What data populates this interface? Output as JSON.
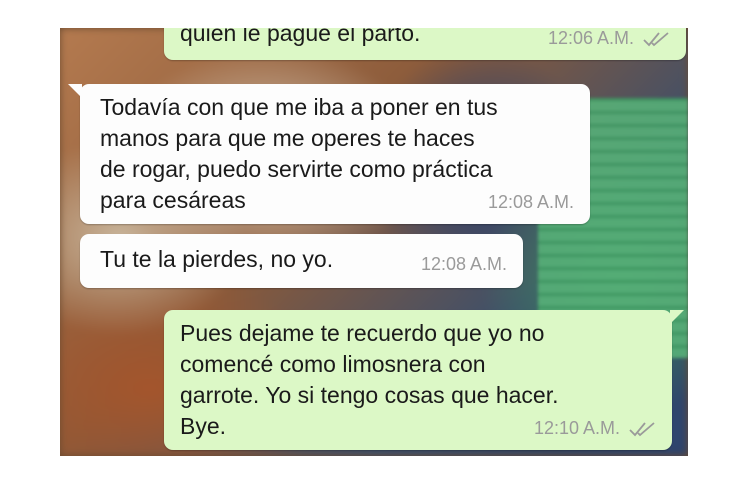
{
  "messages": [
    {
      "direction": "outgoing",
      "text": "quien le pague el parto.",
      "time": "12:06 A.M.",
      "status_icon": "double-check-icon"
    },
    {
      "direction": "incoming",
      "text": "Todavía con que me iba a poner en tus\nmanos para que me operes te haces\nde rogar, puedo servirte como práctica\npara cesáreas",
      "time": "12:08 A.M."
    },
    {
      "direction": "incoming",
      "text": "Tu te la pierdes, no yo.",
      "time": "12:08 A.M."
    },
    {
      "direction": "outgoing",
      "text": "Pues dejame te recuerdo que yo no\ncomencé como limosnera con\ngarrote. Yo si tengo cosas que hacer.\nBye.",
      "time": "12:10 A.M.",
      "status_icon": "double-check-icon"
    }
  ],
  "colors": {
    "incoming_bubble": "#fdfdfd",
    "outgoing_bubble": "#dcf8c6",
    "timestamp": "#9a9a9a",
    "text": "#1a1a1a"
  }
}
